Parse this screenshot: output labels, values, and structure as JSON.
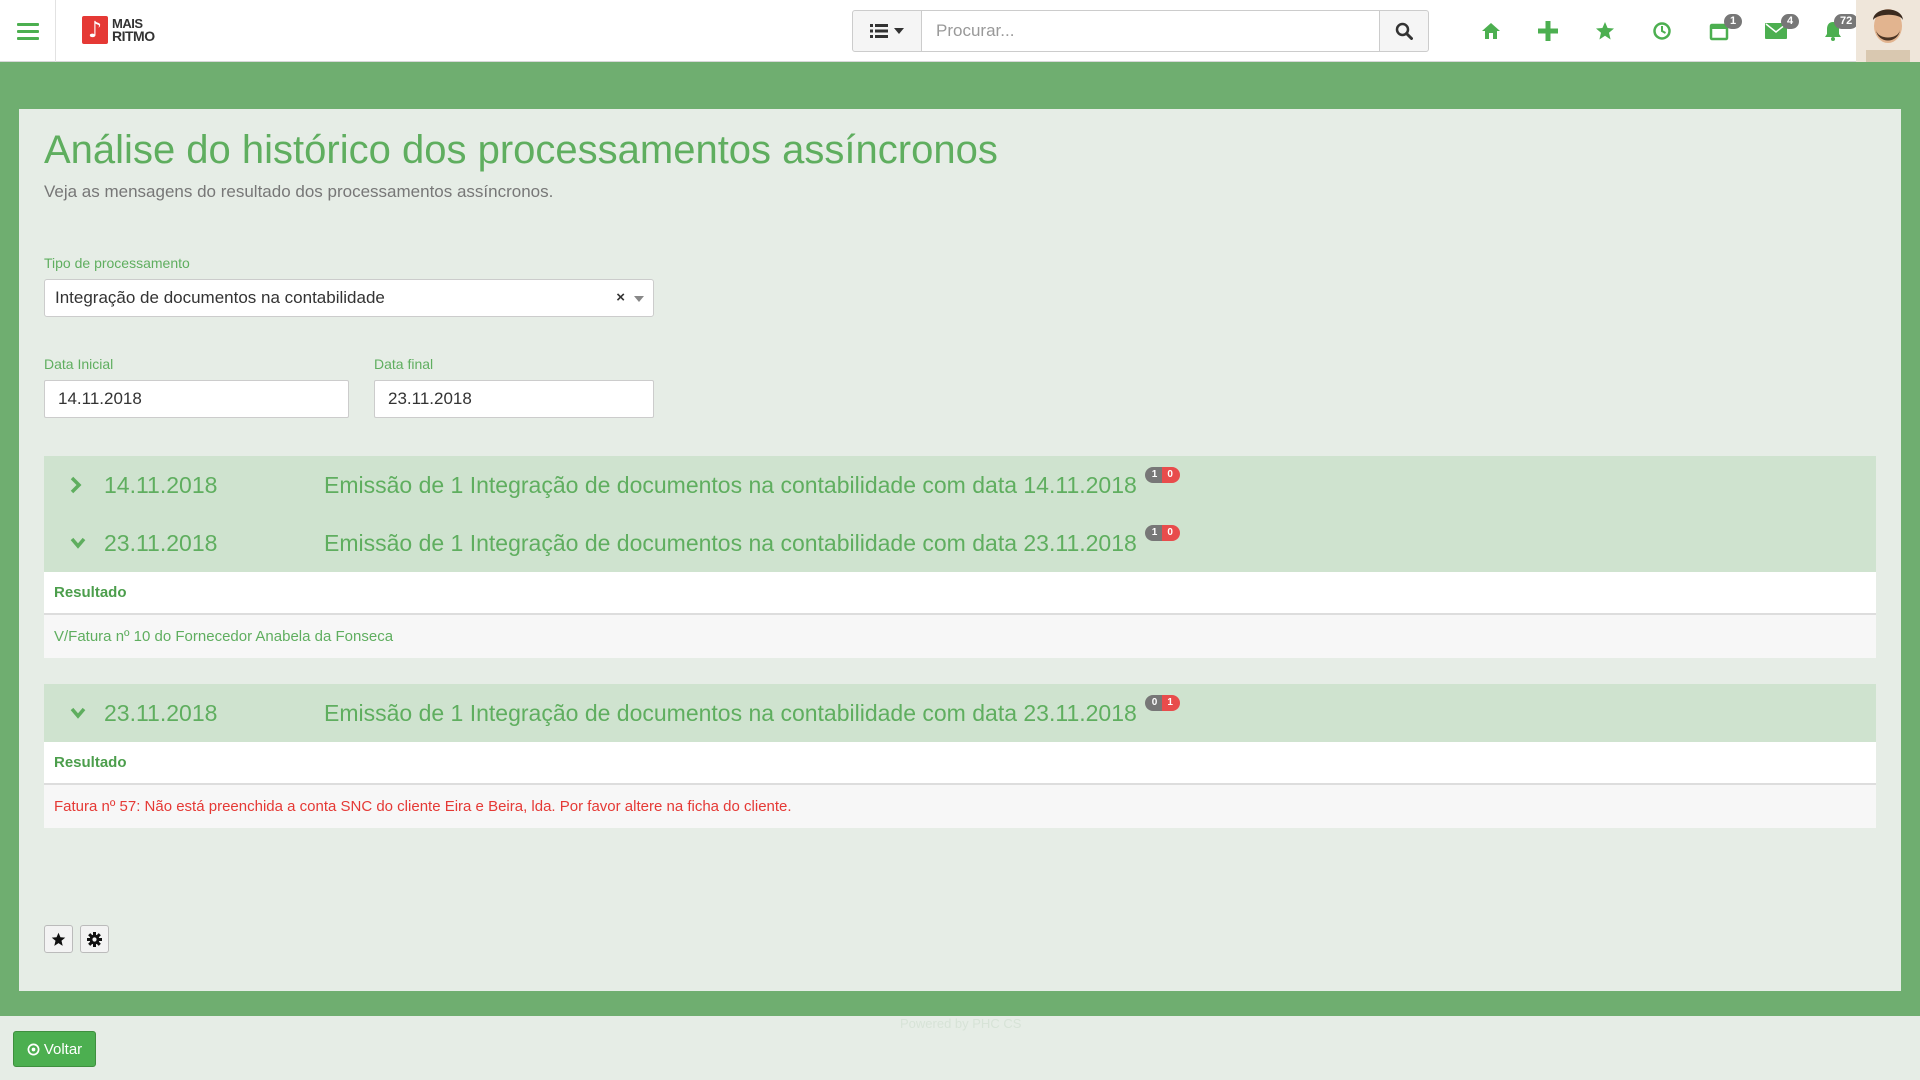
{
  "header": {
    "logo_line1": "MAIS",
    "logo_line2": "RITMO",
    "search_placeholder": "Procurar...",
    "badges": {
      "tasks": "1",
      "messages": "4",
      "notifications": "72"
    }
  },
  "page": {
    "title": "Análise do histórico dos processamentos assíncronos",
    "subtitle": "Veja as mensagens do resultado dos processamentos assíncronos."
  },
  "filters": {
    "type_label": "Tipo de processamento",
    "type_value": "Integração de documentos na contabilidade",
    "clear_symbol": "×",
    "start_label": "Data Inicial",
    "start_value": "14.11.2018",
    "end_label": "Data final",
    "end_value": "23.11.2018"
  },
  "entries": [
    {
      "date": "14.11.2018",
      "text": "Emissão de 1 Integração de documentos na contabilidade com data 14.11.2018",
      "ok": "1",
      "err": "0",
      "expanded": false
    },
    {
      "date": "23.11.2018",
      "text": "Emissão de 1 Integração de documentos na contabilidade com data 23.11.2018",
      "ok": "1",
      "err": "0",
      "expanded": true,
      "result_header": "Resultado",
      "result_text": "V/Fatura nº 10 do Fornecedor Anabela da Fonseca",
      "result_color": "#5fae5f"
    },
    {
      "date": "23.11.2018",
      "text": "Emissão de 1 Integração de documentos na contabilidade com data 23.11.2018",
      "ok": "0",
      "err": "1",
      "expanded": true,
      "result_header": "Resultado",
      "result_text": "Fatura nº 57:  Não está preenchida a conta SNC do cliente Eira e Beira, lda. Por favor altere na ficha do cliente.",
      "result_color": "#e53935"
    }
  ],
  "footer": {
    "powered": "Powered by PHC CS",
    "back_label": "Voltar"
  },
  "colors": {
    "accent": "#4caf50",
    "title_green": "#5fae5f",
    "error_red": "#e53935"
  }
}
